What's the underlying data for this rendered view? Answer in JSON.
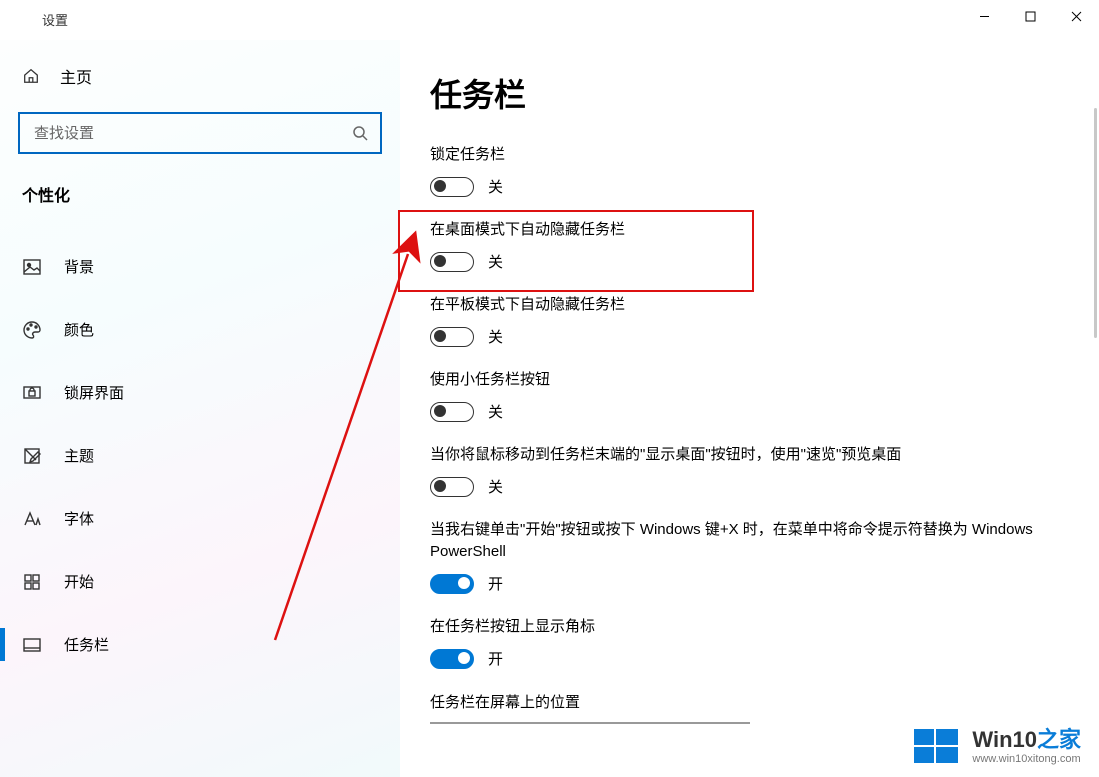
{
  "app_title": "设置",
  "window_controls": {
    "minimize": "minimize",
    "maximize": "maximize",
    "close": "close"
  },
  "home_label": "主页",
  "search": {
    "placeholder": "查找设置"
  },
  "section_heading": "个性化",
  "nav": [
    {
      "key": "background",
      "label": "背景"
    },
    {
      "key": "color",
      "label": "颜色"
    },
    {
      "key": "lockscreen",
      "label": "锁屏界面"
    },
    {
      "key": "theme",
      "label": "主题"
    },
    {
      "key": "font",
      "label": "字体"
    },
    {
      "key": "start",
      "label": "开始"
    },
    {
      "key": "taskbar",
      "label": "任务栏",
      "selected": true
    }
  ],
  "page_title": "任务栏",
  "state_off": "关",
  "state_on": "开",
  "settings": [
    {
      "key": "lock",
      "label": "锁定任务栏",
      "on": false
    },
    {
      "key": "hide_desktop",
      "label": "在桌面模式下自动隐藏任务栏",
      "on": false
    },
    {
      "key": "hide_tablet",
      "label": "在平板模式下自动隐藏任务栏",
      "on": false
    },
    {
      "key": "small_btn",
      "label": "使用小任务栏按钮",
      "on": false
    },
    {
      "key": "peek",
      "label": "当你将鼠标移动到任务栏末端的\"显示桌面\"按钮时，使用\"速览\"预览桌面",
      "on": false
    },
    {
      "key": "powershell",
      "label": "当我右键单击\"开始\"按钮或按下 Windows 键+X 时，在菜单中将命令提示符替换为 Windows PowerShell",
      "on": true
    },
    {
      "key": "badges",
      "label": "在任务栏按钮上显示角标",
      "on": true
    }
  ],
  "location_label": "任务栏在屏幕上的位置",
  "watermark": {
    "brand_en": "Win10",
    "brand_cn": "之家",
    "url": "www.win10xitong.com"
  }
}
